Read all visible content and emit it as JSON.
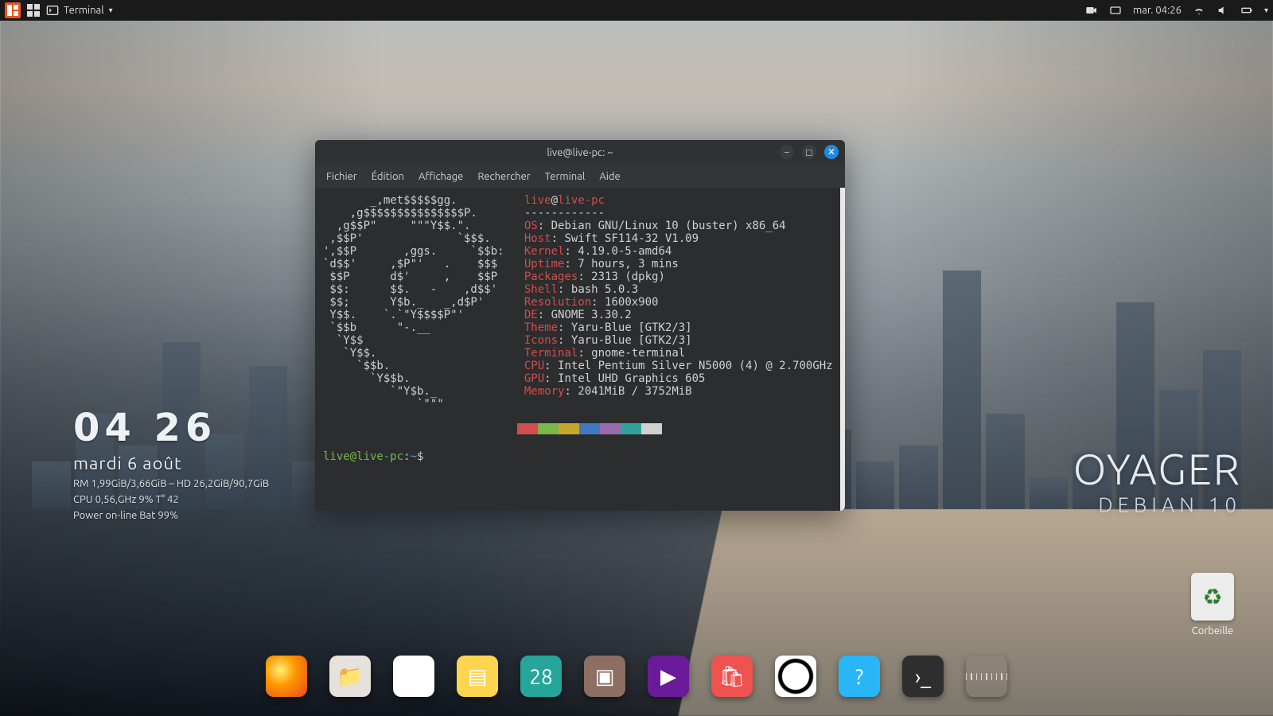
{
  "panel": {
    "app_name": "Terminal",
    "datetime": "mar. 04:26"
  },
  "conky": {
    "time": "04 26",
    "date": "mardi  6 août",
    "line1": "RM 1,99GiB/3,66GiB – HD 26,2GiB/90,7GiB",
    "line2": "CPU 0,56,GHz 9% T° 42",
    "line3": "Power on-line Bat 99%"
  },
  "brand": {
    "big": "OYAGER",
    "sub": "DEBIAN 10"
  },
  "trash": {
    "label": "Corbeille"
  },
  "terminal": {
    "title": "live@live-pc: ~",
    "menu": [
      "Fichier",
      "Édition",
      "Affichage",
      "Rechercher",
      "Terminal",
      "Aide"
    ],
    "prompt_user": "live@live-pc",
    "prompt_path": "~",
    "prompt_symbol": "$",
    "neofetch": {
      "user": "live",
      "host": "live-pc",
      "separator": "------------",
      "logo": [
        "       _,met$$$$$gg.",
        "    ,g$$$$$$$$$$$$$$$P.",
        "  ,g$$P\"     \"\"\"Y$$.\".",
        " ,$$P'              `$$$.",
        "',$$P       ,ggs.     `$$b:",
        "`d$$'     ,$P\"'   .    $$$",
        " $$P      d$'     ,    $$P",
        " $$:      $$.   -    ,d$$'",
        " $$;      Y$b._   _,d$P'",
        " Y$$.    `.`\"Y$$$$P\"'",
        " `$$b      \"-.__",
        "  `Y$$",
        "   `Y$$.",
        "     `$$b.",
        "       `Y$$b.",
        "          `\"Y$b._",
        "              `\"\"\""
      ],
      "info": [
        {
          "label": "OS",
          "value": "Debian GNU/Linux 10 (buster) x86_64"
        },
        {
          "label": "Host",
          "value": "Swift SF114-32 V1.09"
        },
        {
          "label": "Kernel",
          "value": "4.19.0-5-amd64"
        },
        {
          "label": "Uptime",
          "value": "7 hours, 3 mins"
        },
        {
          "label": "Packages",
          "value": "2313 (dpkg)"
        },
        {
          "label": "Shell",
          "value": "bash 5.0.3"
        },
        {
          "label": "Resolution",
          "value": "1600x900"
        },
        {
          "label": "DE",
          "value": "GNOME 3.30.2"
        },
        {
          "label": "Theme",
          "value": "Yaru-Blue [GTK2/3]"
        },
        {
          "label": "Icons",
          "value": "Yaru-Blue [GTK2/3]"
        },
        {
          "label": "Terminal",
          "value": "gnome-terminal"
        },
        {
          "label": "CPU",
          "value": "Intel Pentium Silver N5000 (4) @ 2.700GHz"
        },
        {
          "label": "GPU",
          "value": "Intel UHD Graphics 605"
        },
        {
          "label": "Memory",
          "value": "2041MiB / 3752MiB"
        }
      ],
      "swatches": [
        "#d24d4d",
        "#7ab648",
        "#c7a72b",
        "#3f78c3",
        "#9a6aae",
        "#2fa39a",
        "#d0d0d0"
      ]
    }
  },
  "dock": [
    {
      "name": "firefox"
    },
    {
      "name": "files"
    },
    {
      "name": "gedit"
    },
    {
      "name": "notes"
    },
    {
      "name": "calendar",
      "text": "28"
    },
    {
      "name": "wallpaper"
    },
    {
      "name": "video"
    },
    {
      "name": "software"
    },
    {
      "name": "screenshot"
    },
    {
      "name": "help",
      "text": "?"
    },
    {
      "name": "terminal",
      "text": "›_"
    },
    {
      "name": "apps"
    }
  ]
}
